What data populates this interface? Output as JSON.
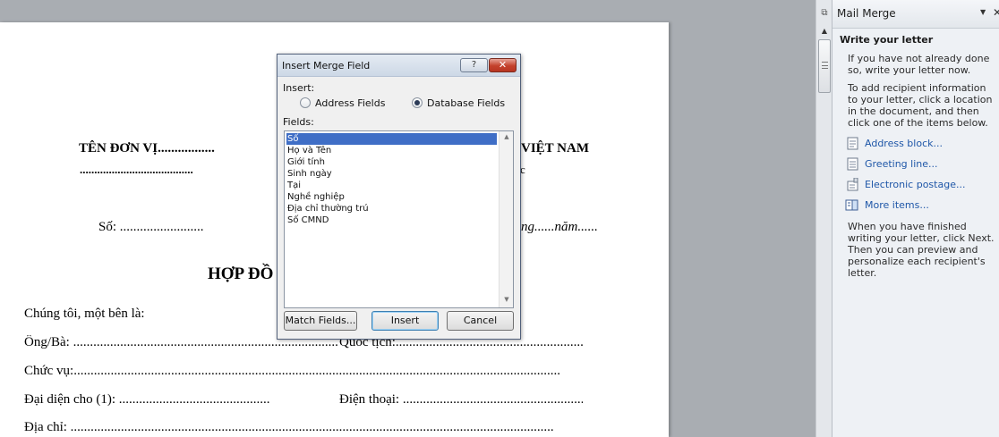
{
  "document": {
    "unit_name": "TÊN ĐƠN VỊ.................",
    "unit_name_line2": ".......................................",
    "nation_partial": "VIỆT NAM",
    "nation_sub_partial": "c",
    "number_label": "Số: .........................",
    "date_partial": "ng......năm......",
    "contract_title_partial": "HỢP ĐỒ",
    "line_parties": "Chúng tôi, một bên là:",
    "line_name": "Ông/Bà:  .............................................................................................................",
    "line_nationality": "Quốc tịch:..........................................................",
    "line_position": "Chức vụ:.................................................................................................................................................",
    "line_represent": "Đại diện cho (1):  .............................................",
    "line_phone": "Điện thoại:  ...........................................................",
    "line_address": "Địa chỉ:  ................................................................................................................................................"
  },
  "dialog": {
    "title": "Insert Merge Field",
    "help_label": "?",
    "close_label": "✕",
    "insert_label": "Insert:",
    "radio_address": "Address Fields",
    "radio_database": "Database Fields",
    "selected_radio": "Database Fields",
    "fields_label": "Fields:",
    "fields": [
      "Số",
      "Họ và Tên",
      "Giới tính",
      "Sinh ngày",
      "Tại",
      "Nghề nghiệp",
      "Địa chỉ thường trú",
      "Số CMND"
    ],
    "selected_field": "Số",
    "btn_match": "Match Fields...",
    "btn_insert": "Insert",
    "btn_cancel": "Cancel"
  },
  "pane": {
    "title": "Mail Merge",
    "section_title": "Write your letter",
    "para1": "If you have not already done so, write your letter now.",
    "para2": "To add recipient information to your letter, click a location in the document, and then click one of the items below.",
    "links": [
      {
        "label": "Address block...",
        "icon": "address-block-icon"
      },
      {
        "label": "Greeting line...",
        "icon": "greeting-line-icon"
      },
      {
        "label": "Electronic postage...",
        "icon": "electronic-postage-icon"
      },
      {
        "label": "More items...",
        "icon": "more-items-icon"
      }
    ],
    "para3": "When you have finished writing your letter, click Next. Then you can preview and personalize each recipient's letter."
  },
  "colors": {
    "selection": "#3f6ec6",
    "link": "#1f57a8",
    "close_button": "#c3412c"
  }
}
